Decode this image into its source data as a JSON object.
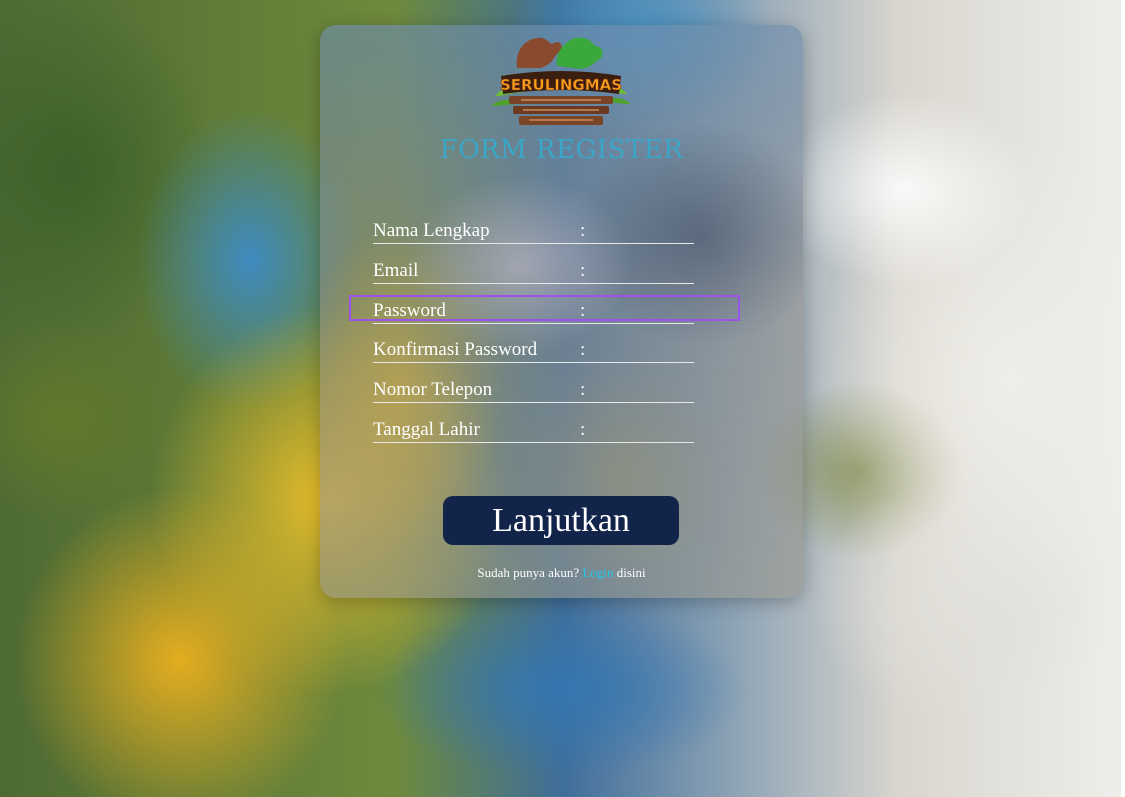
{
  "logo": {
    "text": "SERULINGMAS"
  },
  "form": {
    "title": "FORM REGISTER",
    "fields": [
      {
        "label": "Nama Lengkap",
        "colon": ":",
        "value": ""
      },
      {
        "label": "Email",
        "colon": ":",
        "value": ""
      },
      {
        "label": "Password",
        "colon": ":",
        "value": "",
        "focused": true
      },
      {
        "label": "Konfirmasi Password",
        "colon": ":",
        "value": ""
      },
      {
        "label": "Nomor Telepon",
        "colon": ":",
        "value": ""
      },
      {
        "label": "Tanggal Lahir",
        "colon": ":",
        "value": ""
      }
    ],
    "submit_label": "Lanjutkan"
  },
  "footer": {
    "prefix": "Sudah punya akun?",
    "link": "Login",
    "suffix": "disini"
  },
  "colors": {
    "accent": "#3aa6c8",
    "button": "#12244a",
    "link": "#22c5e8",
    "focus": "#9b53ec"
  }
}
